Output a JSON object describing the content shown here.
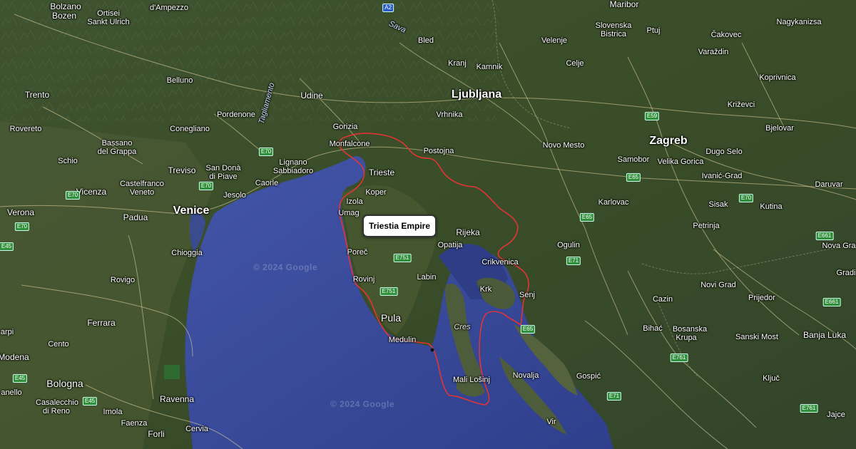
{
  "popup": {
    "label": "Triestia Empire"
  },
  "watermark": {
    "text": "© 2024 Google"
  },
  "colors": {
    "sea": "#3b4da0",
    "land": "#3a4d2a",
    "border": "#e03030",
    "roads": "#e8d9a0"
  },
  "labels": {
    "bolzano": "Bolzano",
    "bozen": "Bozen",
    "ortisei": "Ortisei",
    "sankt_ulrich": "Sankt Ulrich",
    "ampezzo": "d'Ampezzo",
    "maribor": "Maribor",
    "nagykanizsa": "Nagykanizsa",
    "sava": "Sava",
    "bled": "Bled",
    "velenje": "Velenje",
    "slovenska_bistrica": "Slovenska\nBistrica",
    "ptuj": "Ptuj",
    "cakovec": "Čakovec",
    "varazdin": "Varaždin",
    "trento": "Trento",
    "belluno": "Belluno",
    "tagliamento": "Tagliamento",
    "udine": "Udine",
    "kranj": "Kranj",
    "kamnik": "Kamnik",
    "celje": "Celje",
    "koprivnica": "Koprivnica",
    "ljubljana": "Ljubljana",
    "pordenone": "Pordenone",
    "rovereto": "Rovereto",
    "bassano": "Bassano\ndel Grappa",
    "conegliano": "Conegliano",
    "gorizia": "Gorizia",
    "vrhnika": "Vrhnika",
    "krizevci": "Križevci",
    "bjelovar": "Bjelovar",
    "monfalcone": "Monfalcone",
    "postojna": "Postojna",
    "novo_mesto": "Novo Mesto",
    "zagreb": "Zagreb",
    "samobor": "Samobor",
    "velika_gorica": "Velika Gorica",
    "dugo_selo": "Dugo Selo",
    "schio": "Schio",
    "treviso": "Treviso",
    "san_dona": "San Donà\ndi Piave",
    "lignano": "Lignano\nSabbiadoro",
    "trieste": "Trieste",
    "ivanic_grad": "Ivanić-Grad",
    "vicenza": "Vicenza",
    "castelfranco": "Castelfranco\nVeneto",
    "jesolo": "Jesolo",
    "caorle": "Caorle",
    "koper": "Koper",
    "daruvar": "Daruvar",
    "izola": "Izola",
    "karlovac": "Karlovac",
    "sisak": "Sisak",
    "kutina": "Kutina",
    "verona": "Verona",
    "padua": "Padua",
    "venice": "Venice",
    "umag": "Umag",
    "petrinja": "Petrinja",
    "rijeka": "Rijeka",
    "opatija": "Opatija",
    "ogulin": "Ogulin",
    "chioggia": "Chioggia",
    "porec": "Poreč",
    "nova_gra": "Nova Gra",
    "crikvenica": "Crikvenica",
    "rovigo": "Rovigo",
    "rovinj": "Rovinj",
    "labin": "Labin",
    "gradi": "Gradi",
    "krk": "Krk",
    "novi_grad": "Novi Grad",
    "senj": "Senj",
    "prijedor": "Prijedor",
    "cazin": "Cazin",
    "pula": "Pula",
    "ferrara": "Ferrara",
    "cres": "Cres",
    "bihac": "Bihać",
    "bosanska_krupa": "Bosanska\nKrupa",
    "sanski_most": "Sanski Most",
    "banja_luka": "Banja Luka",
    "arpi": "arpi",
    "cento": "Cento",
    "medulin": "Medulin",
    "modena": "Modena",
    "mali_losinj": "Mali Lošinj",
    "novalja": "Novalja",
    "gospic": "Gospić",
    "kljuc": "Ključ",
    "bologna": "Bologna",
    "casalecchio": "Casalecchio\ndi Reno",
    "anello": "anello",
    "ravenna": "Ravenna",
    "imola": "Imola",
    "faenza": "Faenza",
    "forli": "Forli",
    "cervia": "Cervia",
    "vir": "Vir",
    "jajce": "Jajce"
  },
  "roads": {
    "a2": "A2",
    "e70_a": "E70",
    "e70_b": "E70",
    "e70_c": "E70",
    "e70_d": "E70",
    "e70_e": "E70",
    "e59": "E59",
    "e65_a": "E65",
    "e65_b": "E65",
    "e65_c": "E65",
    "e751_a": "E751",
    "e751_b": "E751",
    "e71_a": "E71",
    "e71_b": "E71",
    "e661_a": "E661",
    "e661_b": "E661",
    "e761_a": "E761",
    "e761_b": "E761",
    "e45_a": "E45",
    "e45_b": "E45",
    "e45_c": "E45"
  }
}
